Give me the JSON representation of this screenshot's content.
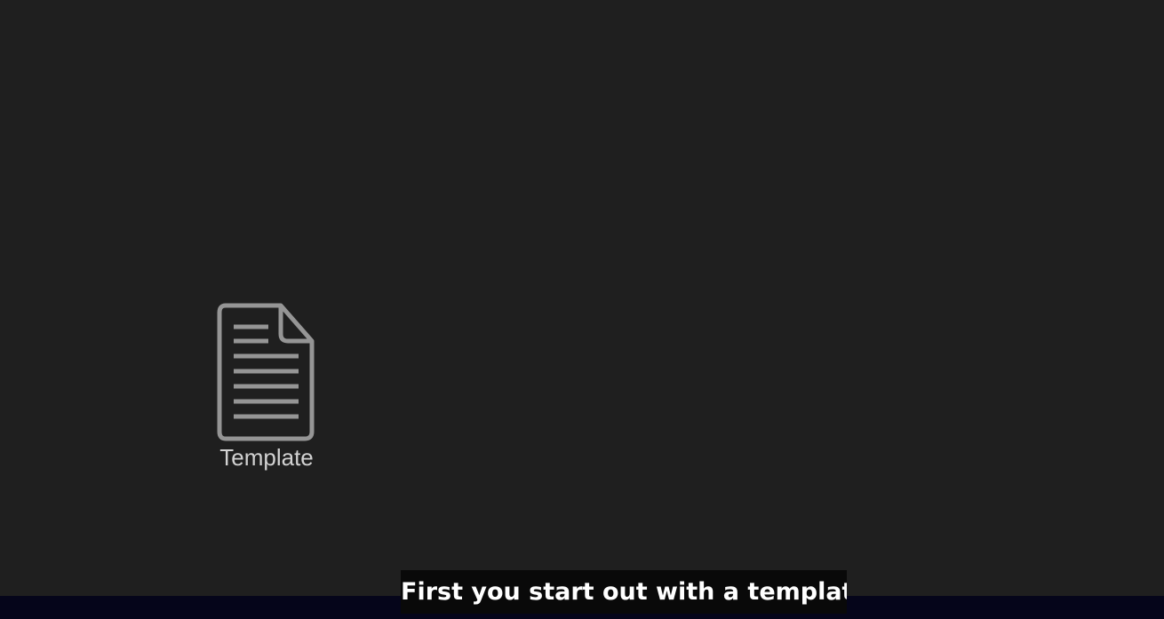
{
  "desktop": {
    "background_color": "#1f1f1f",
    "file": {
      "icon": "document-icon",
      "icon_color": "#959595",
      "label": "Template"
    }
  },
  "caption": {
    "text": "First you start out with a template.",
    "background_color": "#090909",
    "text_color": "#ffffff"
  },
  "bottom_bar": {
    "background_color": "#05051a"
  }
}
